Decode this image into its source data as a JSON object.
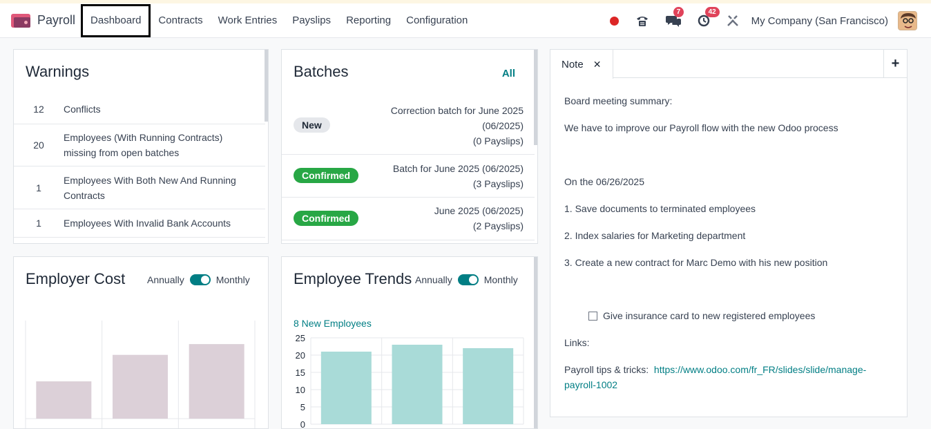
{
  "app": {
    "name": "Payroll"
  },
  "menu": [
    "Dashboard",
    "Contracts",
    "Work Entries",
    "Payslips",
    "Reporting",
    "Configuration"
  ],
  "systray": {
    "messages_count": "7",
    "activities_count": "42",
    "company": "My Company (San Francisco)"
  },
  "warnings": {
    "title": "Warnings",
    "rows": [
      {
        "count": "12",
        "label": "Conflicts"
      },
      {
        "count": "20",
        "label": "Employees (With Running Contracts) missing from open batches"
      },
      {
        "count": "1",
        "label": "Employees With Both New And Running Contracts"
      },
      {
        "count": "1",
        "label": "Employees With Invalid Bank Accounts"
      }
    ]
  },
  "batches": {
    "title": "Batches",
    "all_link": "All",
    "rows": [
      {
        "state": "New",
        "line1": "Correction batch for June 2025",
        "line2": "(06/2025)",
        "line3": "(0 Payslips)"
      },
      {
        "state": "Confirmed",
        "line1": "Batch for June 2025 (06/2025)",
        "line2": "(3 Payslips)"
      },
      {
        "state": "Confirmed",
        "line1": "June 2025 (06/2025)",
        "line2": "(2 Payslips)"
      }
    ]
  },
  "employer_cost": {
    "title": "Employer Cost",
    "toggle_left": "Annually",
    "toggle_right": "Monthly"
  },
  "employee_trends": {
    "title": "Employee Trends",
    "toggle_left": "Annually",
    "toggle_right": "Monthly",
    "summary_link": "8 New Employees"
  },
  "chart_data": [
    {
      "type": "bar",
      "title": "",
      "categories": [
        "",
        "",
        ""
      ],
      "values": [
        0.38,
        0.65,
        0.76
      ],
      "colors": [
        "#dcd0d8"
      ]
    },
    {
      "type": "bar",
      "title": "",
      "categories": [
        "",
        "",
        ""
      ],
      "values": [
        21,
        23,
        22
      ],
      "ylim": [
        0,
        25
      ],
      "yticks": [
        "0",
        "5",
        "10",
        "15",
        "20",
        "25"
      ],
      "colors": [
        "#a9dbd8"
      ]
    }
  ],
  "note": {
    "tab_label": "Note",
    "lines": [
      "Board meeting summary:",
      "We have to improve our Payroll flow with the new Odoo process",
      "On the 06/26/2025",
      "1. Save documents to terminated employees",
      "2. Index salaries for Marketing department",
      "3. Create a new contract for Marc Demo with his new position"
    ],
    "checklist_item": "Give insurance card to new registered employees",
    "links_label": "Links:",
    "tips_label": "Payroll tips & tricks:",
    "tips_url_1": "https://www.odoo.com/fr_FR/slides/slide/manage-",
    "tips_url_2": "payroll-1002"
  }
}
